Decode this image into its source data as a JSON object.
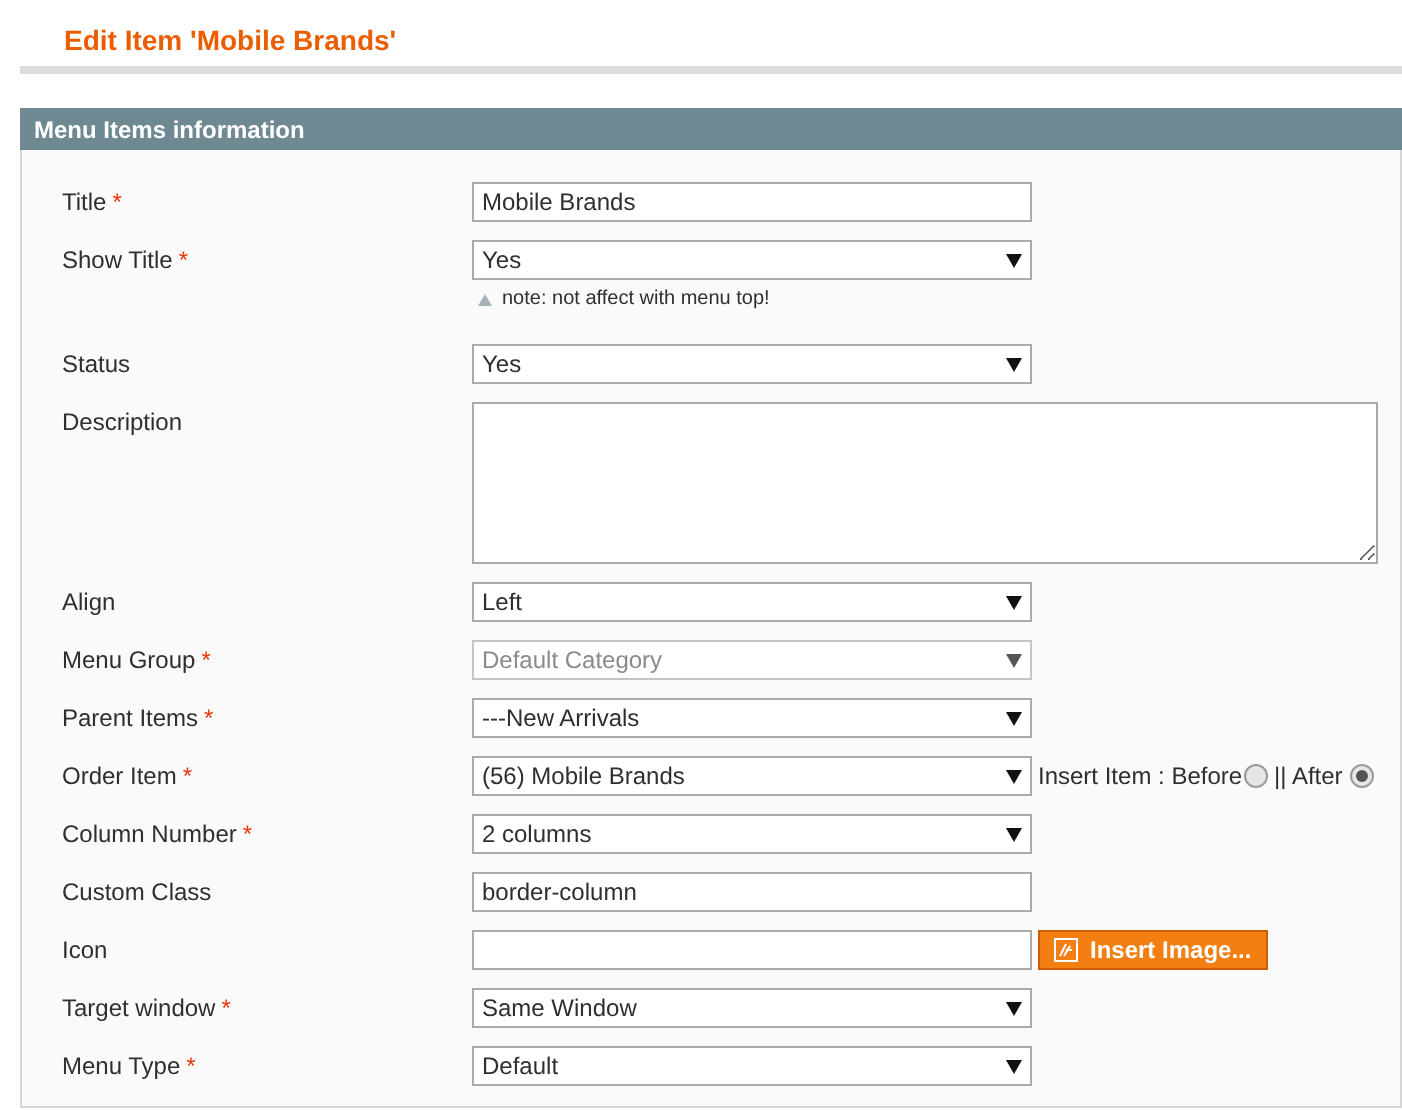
{
  "page_title": "Edit Item 'Mobile Brands'",
  "section": {
    "title": "Menu Items information"
  },
  "fields": [
    {
      "label": "Title",
      "required_mark": "*",
      "kind": "text",
      "value": "Mobile Brands"
    },
    {
      "label": "Show Title",
      "required_mark": "*",
      "kind": "select",
      "value": "Yes",
      "note": "note: not affect with menu top!"
    },
    {
      "label": "Status",
      "kind": "select",
      "value": "Yes"
    },
    {
      "label": "Description",
      "kind": "textarea"
    },
    {
      "label": "Align",
      "kind": "select",
      "value": "Left"
    },
    {
      "label": "Menu Group",
      "required_mark": "*",
      "kind": "select",
      "value": "Default Category",
      "disabled": true
    },
    {
      "label": "Parent Items",
      "required_mark": "*",
      "kind": "select",
      "value": "---New Arrivals"
    },
    {
      "label": "Order Item",
      "required_mark": "*",
      "kind": "select",
      "value": "(56) Mobile Brands",
      "insert": {
        "label": "Insert Item : ",
        "options": [
          {
            "label": "Before",
            "selected": false
          },
          {
            "label": "|| After",
            "selected": true
          }
        ]
      }
    },
    {
      "label": "Column Number",
      "required_mark": "*",
      "kind": "select",
      "value": "2 columns"
    },
    {
      "label": "Custom Class",
      "kind": "text",
      "value": "border-column"
    },
    {
      "label": "Icon",
      "kind": "text",
      "button": "Insert Image..."
    },
    {
      "label": "Target window",
      "required_mark": "*",
      "kind": "select",
      "value": "Same Window"
    },
    {
      "label": "Menu Type",
      "required_mark": "*",
      "kind": "select",
      "value": "Default"
    }
  ]
}
